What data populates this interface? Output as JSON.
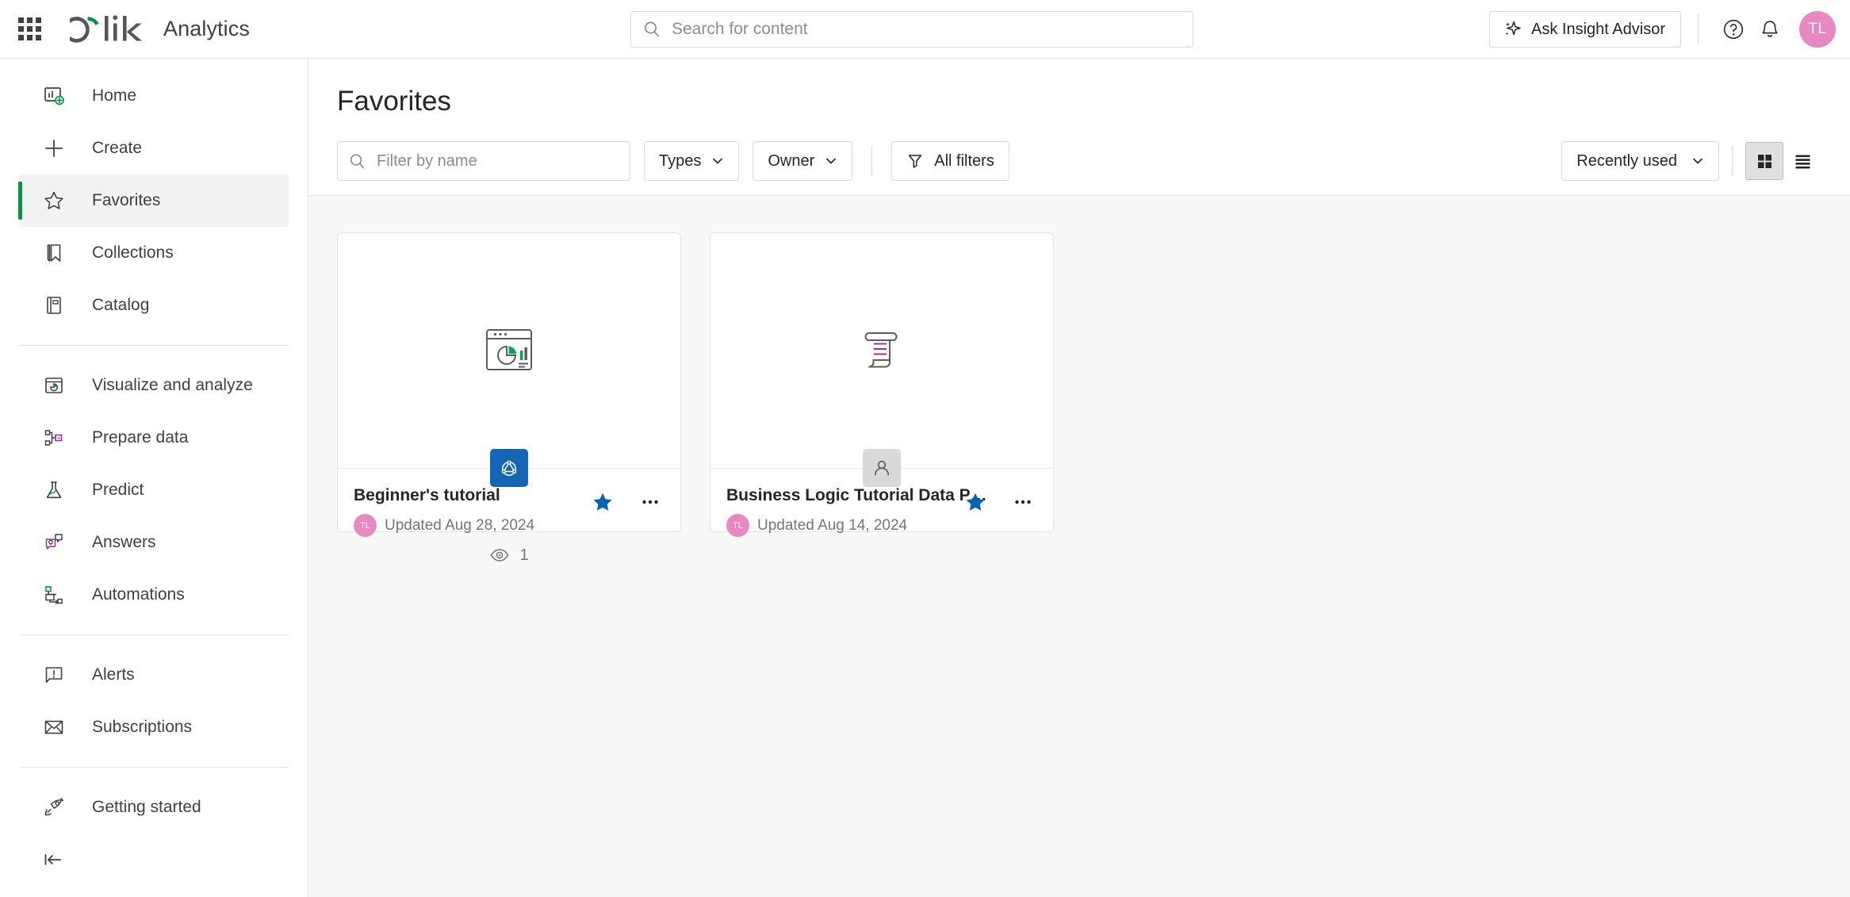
{
  "topbar": {
    "launcher_label": "app-launcher",
    "brand_name": "Qlik",
    "brand_product": "Analytics",
    "search_placeholder": "Search for content",
    "ask_label": "Ask Insight Advisor",
    "avatar_initials": "TL",
    "accent_green": "#009845",
    "avatar_color": "#e988c0"
  },
  "sidebar": {
    "group1": [
      {
        "label": "Home",
        "icon": "home-dashboard-icon",
        "active": false
      },
      {
        "label": "Create",
        "icon": "plus-icon",
        "active": false
      },
      {
        "label": "Favorites",
        "icon": "star-outline-icon",
        "active": true
      },
      {
        "label": "Collections",
        "icon": "bookmark-icon",
        "active": false
      },
      {
        "label": "Catalog",
        "icon": "book-icon",
        "active": false
      }
    ],
    "group2": [
      {
        "label": "Visualize and analyze",
        "icon": "chart-window-icon"
      },
      {
        "label": "Prepare data",
        "icon": "data-prep-icon"
      },
      {
        "label": "Predict",
        "icon": "flask-icon"
      },
      {
        "label": "Answers",
        "icon": "chat-answers-icon"
      },
      {
        "label": "Automations",
        "icon": "automation-flow-icon"
      }
    ],
    "group3": [
      {
        "label": "Alerts",
        "icon": "alert-bubble-icon"
      },
      {
        "label": "Subscriptions",
        "icon": "envelope-icon"
      }
    ],
    "group4": [
      {
        "label": "Getting started",
        "icon": "rocket-icon"
      }
    ],
    "collapse_label": "collapse-sidebar"
  },
  "main": {
    "title": "Favorites",
    "filter_placeholder": "Filter by name",
    "types_label": "Types",
    "owner_label": "Owner",
    "all_filters_label": "All filters",
    "sort_label": "Recently used",
    "grid_view_label": "grid-view",
    "list_view_label": "list-view",
    "views_count": "1"
  },
  "cards": [
    {
      "name": "Beginner's tutorial",
      "updated": "Updated Aug 28, 2024",
      "owner_initials": "TL",
      "thumb_icon": "chart-window-thumbnail",
      "badge_type": "app",
      "badge_icon": "qlik-app-icon",
      "favorited": true,
      "star_color": "#0064b4"
    },
    {
      "name": "Business Logic Tutorial Data Prep",
      "updated": "Updated Aug 14, 2024",
      "owner_initials": "TL",
      "thumb_icon": "script-scroll-thumbnail",
      "badge_type": "dataset",
      "badge_icon": "person-icon",
      "favorited": true,
      "star_color": "#0064b4"
    }
  ]
}
